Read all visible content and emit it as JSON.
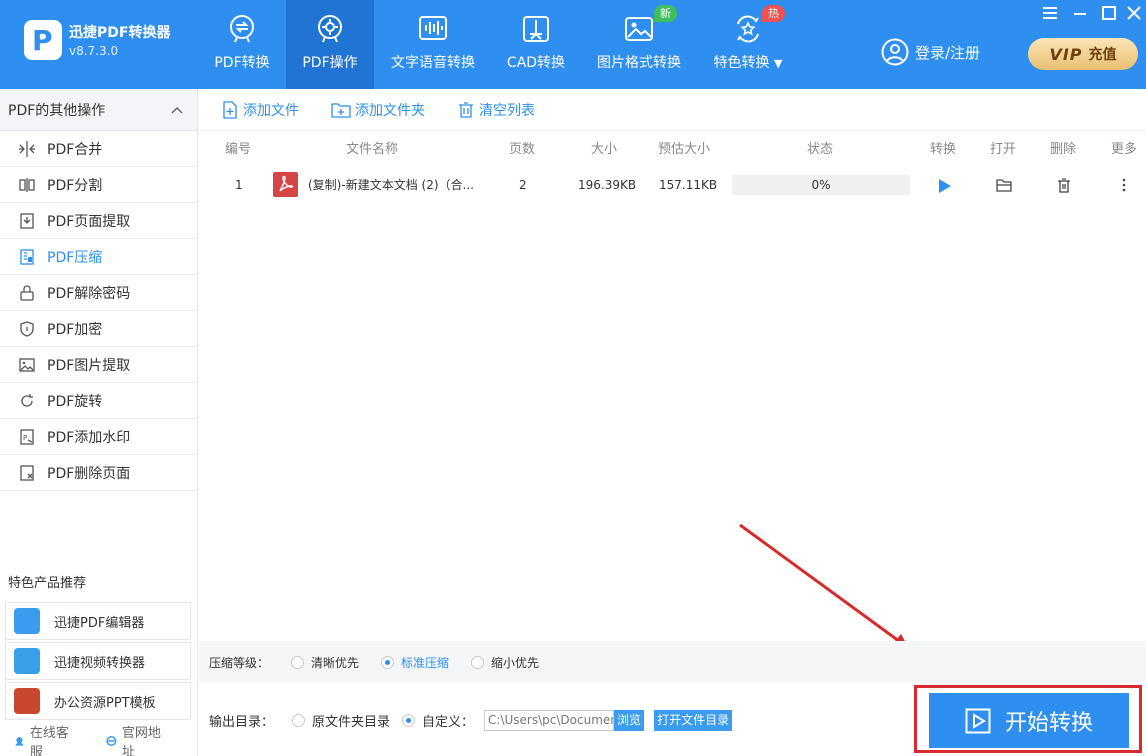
{
  "app": {
    "name": "迅捷PDF转换器",
    "version": "v8.7.3.0"
  },
  "nav": [
    {
      "label": "PDF转换",
      "active": false
    },
    {
      "label": "PDF操作",
      "active": true
    },
    {
      "label": "文字语音转换",
      "active": false
    },
    {
      "label": "CAD转换",
      "active": false
    },
    {
      "label": "图片格式转换",
      "active": false,
      "badge": "新"
    },
    {
      "label": "特色转换",
      "active": false,
      "badge": "热"
    }
  ],
  "account": {
    "login_label": "登录/注册",
    "vip_text": "VIP",
    "vip_label": "充值"
  },
  "sidebar": {
    "header": "PDF的其他操作",
    "items": [
      {
        "label": "PDF合并"
      },
      {
        "label": "PDF分割"
      },
      {
        "label": "PDF页面提取"
      },
      {
        "label": "PDF压缩",
        "active": true
      },
      {
        "label": "PDF解除密码"
      },
      {
        "label": "PDF加密"
      },
      {
        "label": "PDF图片提取"
      },
      {
        "label": "PDF旋转"
      },
      {
        "label": "PDF添加水印"
      },
      {
        "label": "PDF删除页面"
      }
    ],
    "recommend_title": "特色产品推荐",
    "recommend": [
      {
        "label": "迅捷PDF编辑器"
      },
      {
        "label": "迅捷视频转换器"
      },
      {
        "label": "办公资源PPT模板"
      }
    ],
    "footer": {
      "service": "在线客服",
      "website": "官网地址"
    }
  },
  "toolbar": {
    "add_file": "添加文件",
    "add_folder": "添加文件夹",
    "clear_list": "清空列表"
  },
  "table": {
    "headers": [
      "编号",
      "文件名称",
      "页数",
      "大小",
      "预估大小",
      "状态",
      "转换",
      "打开",
      "删除",
      "更多"
    ],
    "rows": [
      {
        "index": "1",
        "name": "(复制)-新建文本文档 (2)（合...",
        "pages": "2",
        "size": "196.39KB",
        "estimated": "157.11KB",
        "progress": "0%"
      }
    ]
  },
  "compress": {
    "label": "压缩等级：",
    "options": [
      "清晰优先",
      "标准压缩",
      "缩小优先"
    ],
    "selected": "标准压缩"
  },
  "output": {
    "label": "输出目录：",
    "option_original": "原文件夹目录",
    "option_custom": "自定义：",
    "path": "C:\\Users\\pc\\Documen",
    "browse": "浏览",
    "open_dir": "打开文件目录"
  },
  "start_label": "开始转换",
  "colors": {
    "brand": "#2e8ff0",
    "highlight": "#d92b2b"
  }
}
